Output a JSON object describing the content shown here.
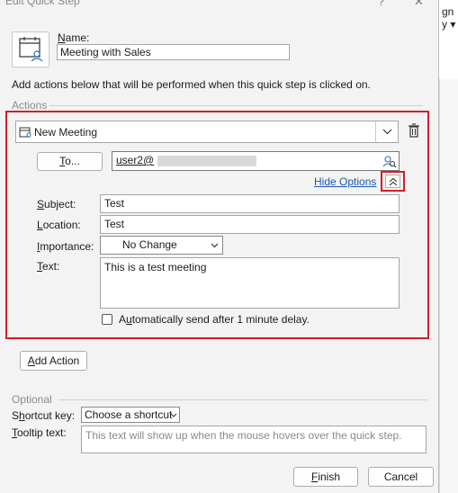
{
  "window": {
    "title": "Edit Quick Step",
    "help_glyph": "?",
    "close_glyph": "✕"
  },
  "background_app": {
    "text_line1": "gn",
    "text_line2": "y ▾"
  },
  "name": {
    "label": "Name:",
    "value": "Meeting with Sales"
  },
  "instructions": "Add actions below that will be performed when this quick step is clicked on.",
  "actions_section": {
    "label": "Actions",
    "action_type": "New Meeting",
    "to_button": "To...",
    "to_value": "user2@",
    "hide_options": "Hide Options",
    "collapse_glyph": "⌃",
    "subject_label": "Subject:",
    "subject_value": "Test",
    "location_label": "Location:",
    "location_value": "Test",
    "importance_label": "Importance:",
    "importance_value": "No Change",
    "text_label": "Text:",
    "text_value": "This is a test meeting",
    "auto_send_label": "Automatically send after 1 minute delay."
  },
  "add_action_button": "Add Action",
  "optional": {
    "label": "Optional",
    "shortcut_label": "Shortcut key:",
    "shortcut_value": "Choose a shortcut",
    "tooltip_label": "Tooltip text:",
    "tooltip_placeholder": "This text will show up when the mouse hovers over the quick step."
  },
  "footer": {
    "finish": "Finish",
    "cancel": "Cancel"
  },
  "colors": {
    "highlight": "#d21f2a",
    "link": "#1a56b5"
  }
}
